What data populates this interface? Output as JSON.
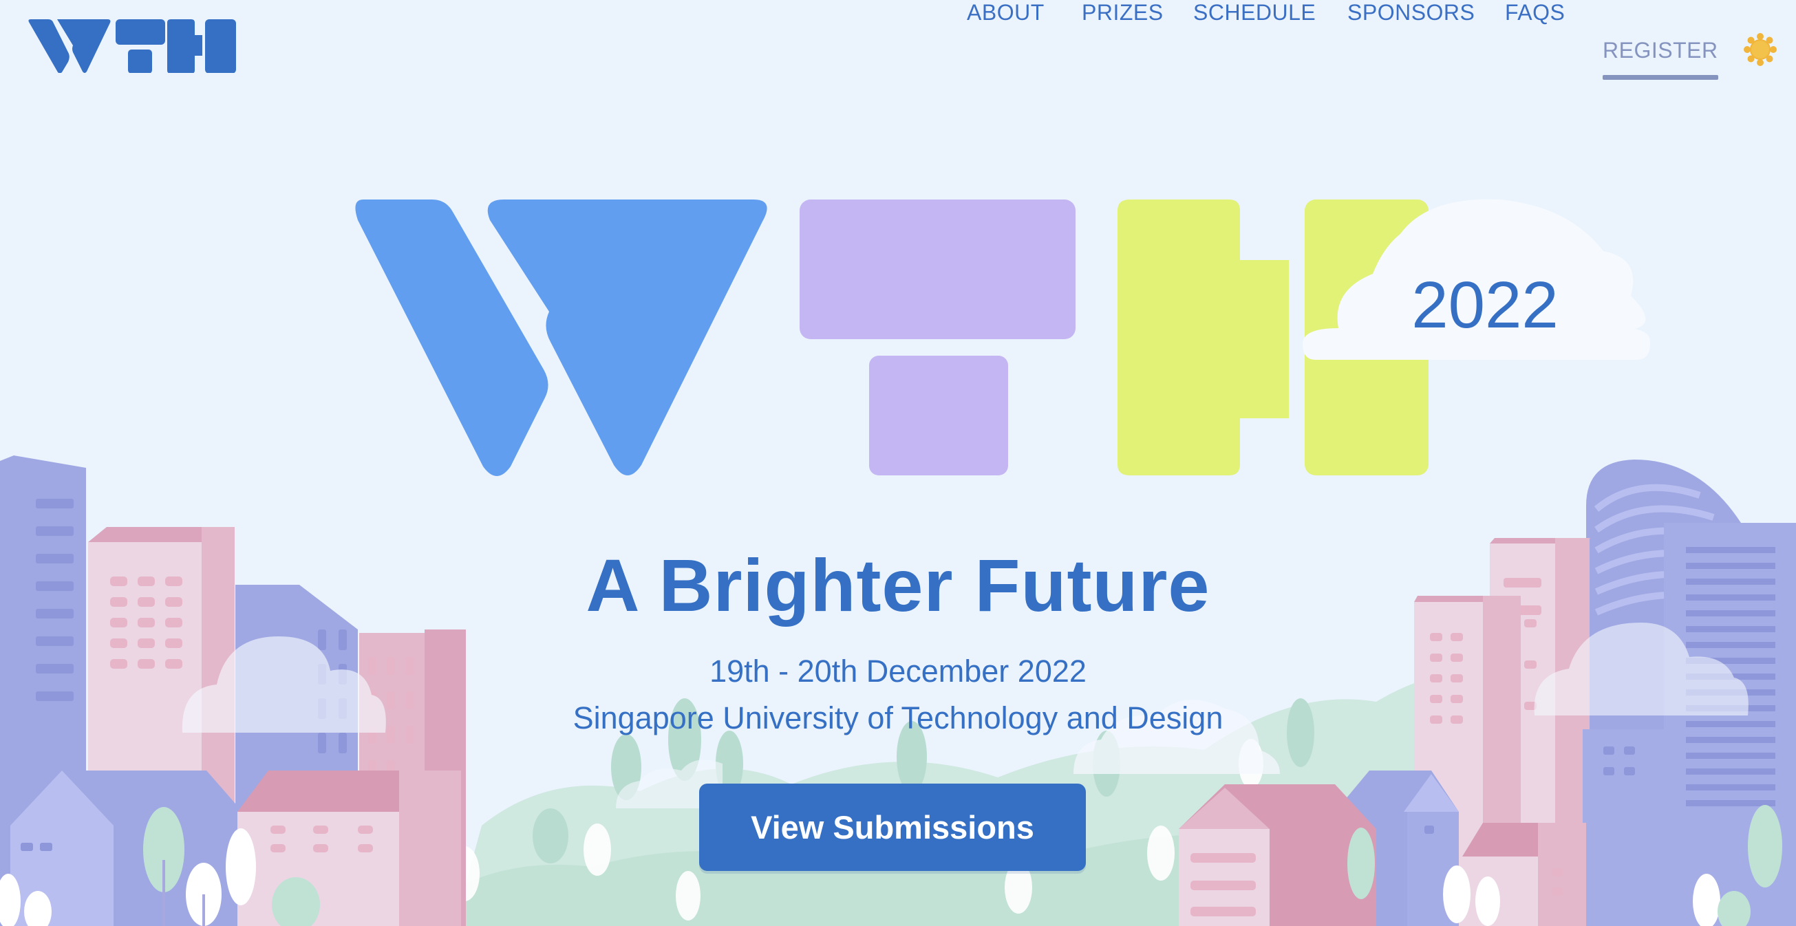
{
  "brand": {
    "logo_name": "wth-logo",
    "year": "2022"
  },
  "nav": {
    "items": [
      {
        "label": "ABOUT"
      },
      {
        "label": "PRIZES"
      },
      {
        "label": "SCHEDULE"
      },
      {
        "label": "SPONSORS"
      },
      {
        "label": "FAQS"
      },
      {
        "label": "REGISTER",
        "active": true
      }
    ],
    "theme_toggle_icon": "sun-icon"
  },
  "hero": {
    "title": "A Brighter Future",
    "date": "19th - 20th December 2022",
    "venue": "Singapore University of Technology and Design",
    "cta_label": "View Submissions"
  },
  "colors": {
    "background": "#ebf4fd",
    "primary": "#3570c4",
    "logo_blue": "#619ef0",
    "logo_purple": "#c4b5f3",
    "logo_yellow": "#e1f277",
    "nav_active": "#8594bf",
    "sun": "#f0b53a"
  }
}
